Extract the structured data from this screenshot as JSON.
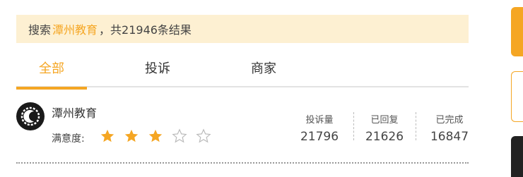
{
  "search": {
    "prefix": "搜索",
    "keyword": "潭州教育",
    "suffix": "，共21946条结果"
  },
  "tabs": [
    {
      "label": "全部",
      "active": true
    },
    {
      "label": "投诉",
      "active": false
    },
    {
      "label": "商家",
      "active": false
    }
  ],
  "merchant": {
    "name": "潭州教育",
    "satisfaction_label": "满意度:",
    "rating": 3,
    "rating_max": 5,
    "stats": [
      {
        "label": "投诉量",
        "value": "21796"
      },
      {
        "label": "已回复",
        "value": "21626"
      },
      {
        "label": "已完成",
        "value": "16847"
      }
    ]
  },
  "colors": {
    "accent": "#f5a623",
    "banner_bg": "#fdf0d2",
    "logo_bg": "#1a1a1a"
  }
}
